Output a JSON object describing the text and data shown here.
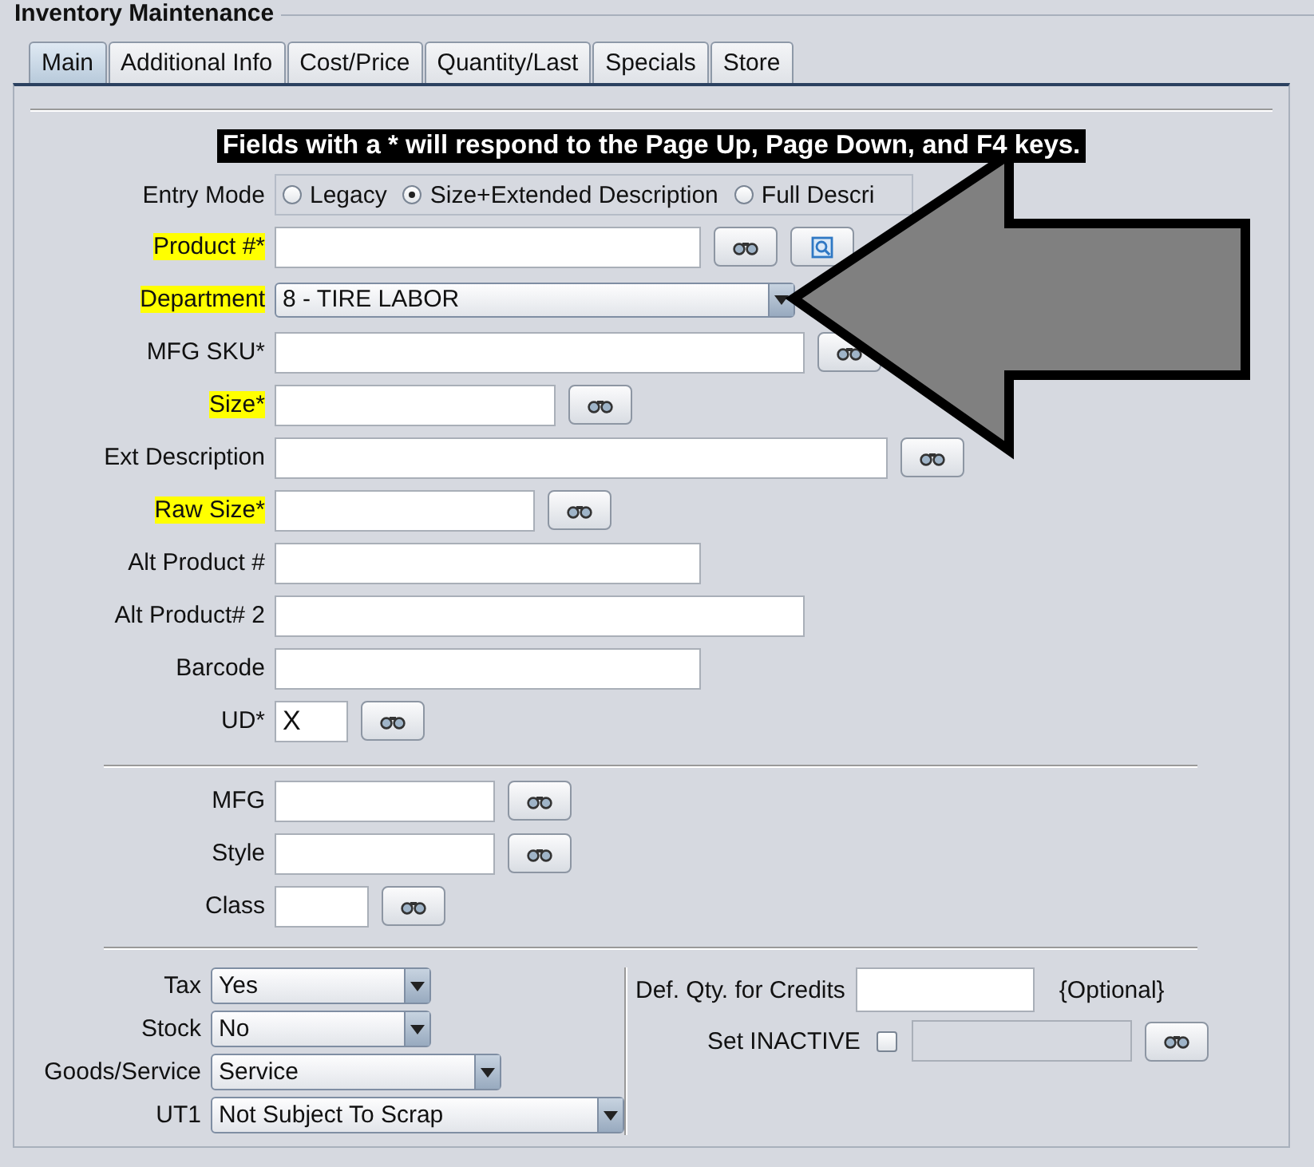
{
  "window": {
    "title": "Inventory Maintenance"
  },
  "tabs": [
    {
      "label": "Main",
      "selected": true
    },
    {
      "label": "Additional Info",
      "selected": false
    },
    {
      "label": "Cost/Price",
      "selected": false
    },
    {
      "label": "Quantity/Last",
      "selected": false
    },
    {
      "label": "Specials",
      "selected": false
    },
    {
      "label": "Store",
      "selected": false
    }
  ],
  "notice": "Fields with a * will respond to the Page Up, Page Down, and F4 keys.",
  "entry_mode": {
    "label": "Entry Mode",
    "options": [
      {
        "label": "Legacy",
        "selected": false
      },
      {
        "label": "Size+Extended Description",
        "selected": true
      },
      {
        "label": "Full Descri",
        "selected": false
      }
    ]
  },
  "fields": [
    {
      "label": "Product #*",
      "kind": "text",
      "highlighted": true,
      "lookup": true,
      "preview": true
    },
    {
      "label": "Department",
      "kind": "select",
      "highlighted": true,
      "value": "8 - TIRE LABOR",
      "lookup": false
    },
    {
      "label": "MFG SKU*",
      "kind": "text",
      "highlighted": false,
      "lookup": true
    },
    {
      "label": "Size*",
      "kind": "text",
      "highlighted": true,
      "lookup": true
    },
    {
      "label": "Ext Description",
      "kind": "text",
      "highlighted": false,
      "lookup": true
    },
    {
      "label": "Raw Size*",
      "kind": "text",
      "highlighted": true,
      "lookup": true
    },
    {
      "label": "Alt Product #",
      "kind": "text",
      "highlighted": false,
      "lookup": false
    },
    {
      "label": "Alt Product# 2",
      "kind": "text",
      "highlighted": false,
      "lookup": false
    },
    {
      "label": "Barcode",
      "kind": "text",
      "highlighted": false,
      "lookup": false
    },
    {
      "label": "UD*",
      "kind": "text",
      "highlighted": false,
      "value": "X",
      "lookup": true
    }
  ],
  "classification": [
    {
      "label": "MFG",
      "lookup": true
    },
    {
      "label": "Style",
      "lookup": true
    },
    {
      "label": "Class",
      "lookup": true
    }
  ],
  "options": [
    {
      "label": "Tax",
      "value": "Yes"
    },
    {
      "label": "Stock",
      "value": "No"
    },
    {
      "label": "Goods/Service",
      "value": "Service"
    },
    {
      "label": "UT1",
      "value": "Not Subject To Scrap"
    }
  ],
  "credits": {
    "label": "Def. Qty. for Credits",
    "note": "{Optional}"
  },
  "inactive": {
    "label": "Set INACTIVE",
    "checked": false,
    "field_disabled": true,
    "lookup": true
  }
}
